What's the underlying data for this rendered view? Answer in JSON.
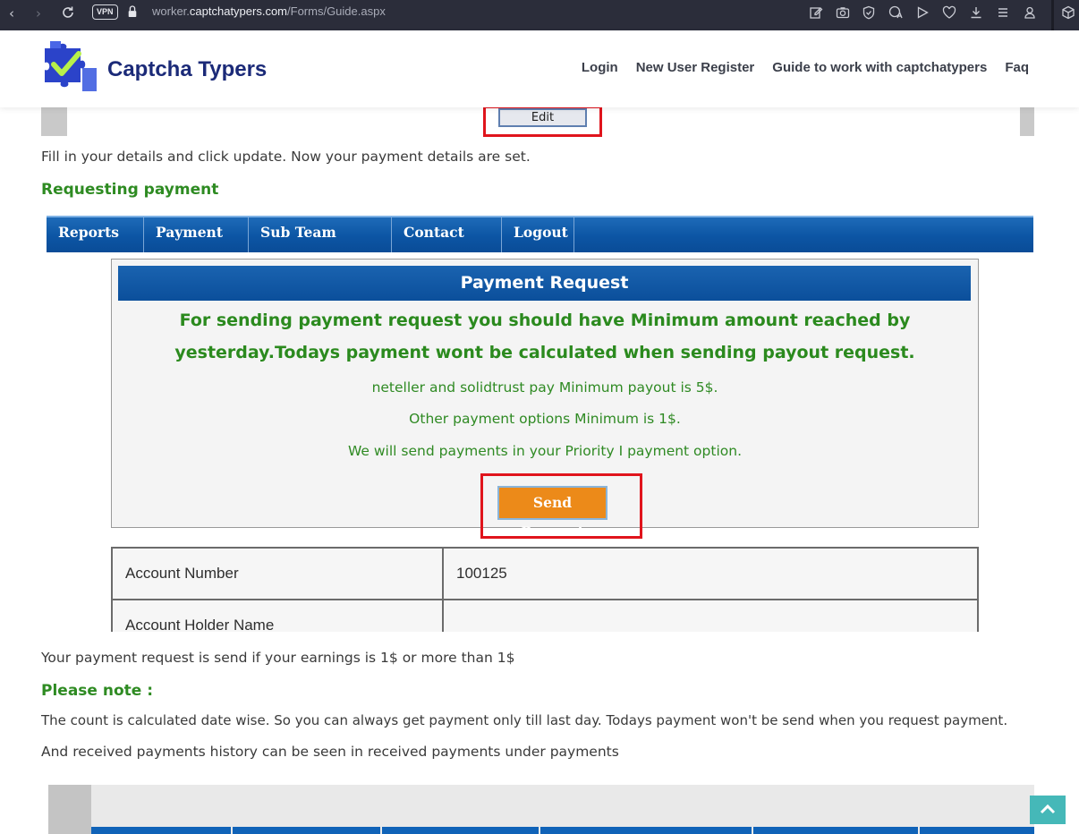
{
  "browser": {
    "vpn_label": "VPN",
    "url_prefix": "worker.",
    "url_domain": "captchatypers.com",
    "url_path": "/Forms/Guide.aspx"
  },
  "site": {
    "logo_text": "Captcha Typers",
    "nav": [
      "Login",
      "New User Register",
      "Guide to work with captchatypers",
      "Faq"
    ]
  },
  "guide": {
    "edit_label": "Edit",
    "fill_details_text": "Fill in your details and click update. Now your payment details are set.",
    "requesting_heading": "Requesting payment",
    "after_request_text": "Your payment request is send if your earnings is 1$ or more than 1$",
    "please_note_heading": "Please note :",
    "note_line_1": "The count is calculated date wise. So you can always get payment only till last day. Todays payment won't be send when you request payment.",
    "note_line_2": "And received payments history can be seen in received payments under payments"
  },
  "payment_shot": {
    "menu": [
      "Reports",
      "Payment",
      "Sub Team Admin",
      "Contact Info",
      "Logout"
    ],
    "title": "Payment Request",
    "line_1": "For sending payment request you should have Minimum amount reached by",
    "line_2": "yesterday.Todays payment wont be calculated when sending payout request.",
    "line_3": "neteller and solidtrust pay Minimum payout is 5$.",
    "line_4": "Other payment options Minimum is 1$.",
    "line_5": "We will send payments in your Priority I payment option.",
    "send_label": "Send Request",
    "table": [
      {
        "label": "Account Number",
        "value": "100125"
      },
      {
        "label": "Account Holder Name",
        "value": ""
      }
    ]
  },
  "colors": {
    "brand_navy": "#1b2a78",
    "heading_green": "#2e8b22",
    "menu_blue": "#0c55a4",
    "highlight_red": "#e0141c",
    "send_orange": "#ec8a19",
    "scroll_teal": "#45b8b8"
  },
  "icons": [
    "back-icon",
    "forward-icon",
    "reload-icon",
    "lock-icon",
    "edit-page-icon",
    "camera-icon",
    "shield-icon",
    "translate-icon",
    "play-icon",
    "heart-icon",
    "download-icon",
    "menu-icon",
    "profile-icon",
    "extension-icon",
    "chevron-up-icon"
  ]
}
